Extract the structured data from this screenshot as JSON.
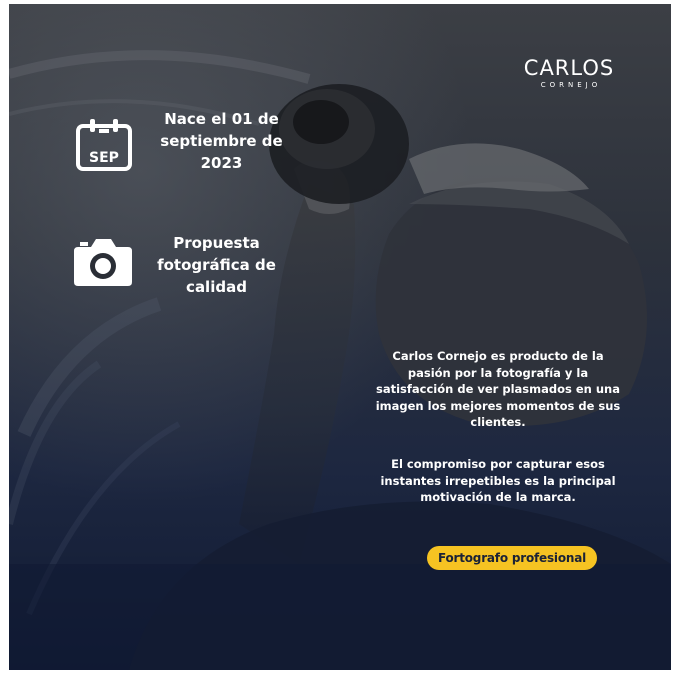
{
  "logo": {
    "name": "CARLOS",
    "surname": "CORNEJO"
  },
  "features": [
    {
      "icon": "calendar-icon",
      "icon_label": "SEP",
      "text": "Nace el 01 de septiembre de 2023"
    },
    {
      "icon": "camera-icon",
      "text": "Propuesta fotográfica de calidad"
    }
  ],
  "description": {
    "paragraph1": "Carlos Cornejo es producto de la pasión por la fotografía y la satisfacción de ver plasmados en una imagen los mejores momentos de sus clientes.",
    "paragraph2": "El compromiso por capturar esos instantes irrepetibles es la principal motivación de la marca."
  },
  "badge": {
    "label": "Fortografo profesional"
  },
  "colors": {
    "accent": "#f6c322",
    "text": "#ffffff",
    "background_dark": "#15203a"
  }
}
